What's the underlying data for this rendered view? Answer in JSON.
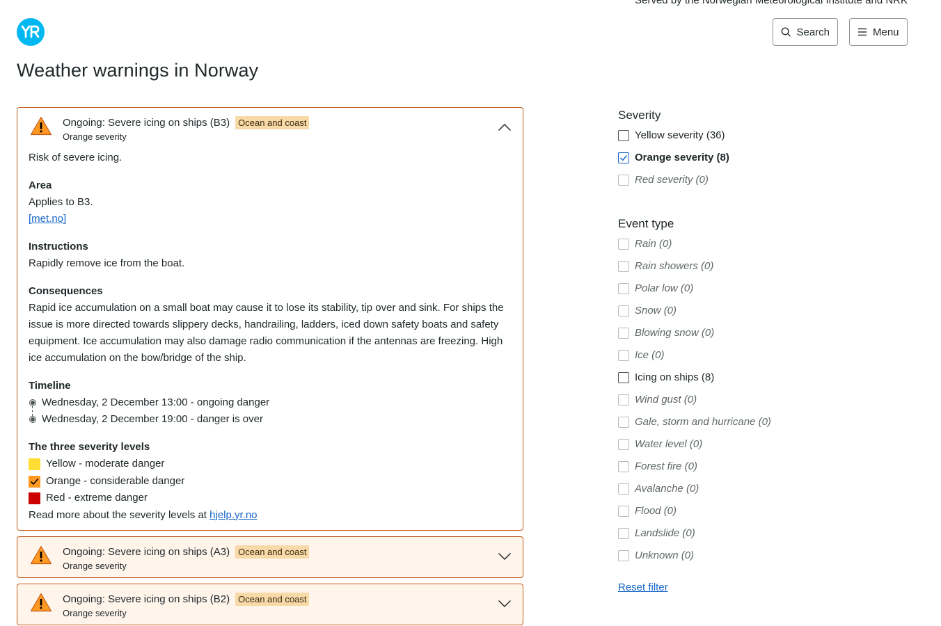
{
  "header": {
    "tagline": "Served by the Norwegian Meteorological Institute and NRK",
    "logo_text": "YR",
    "search_label": "Search",
    "menu_label": "Menu"
  },
  "page_title": "Weather warnings in Norway",
  "warnings": [
    {
      "title": "Ongoing: Severe icing on ships (B3)",
      "badge": "Ocean and coast",
      "severity": "Orange severity",
      "expanded": true,
      "description": "Risk of severe icing.",
      "area_title": "Area",
      "area_text": "Applies to B3.",
      "area_link": "[met.no]",
      "instructions_title": "Instructions",
      "instructions_text": "Rapidly remove ice from the boat.",
      "consequences_title": "Consequences",
      "consequences_text": "Rapid ice accumulation on a small boat may cause it to lose its stability, tip over and sink. For ships the issue is more directed towards slippery decks, handrailing, ladders, iced down safety boats and safety equipment. Ice accumulation may also damage radio communication if the antennas are freezing. High ice accumulation on the bow/bridge of the ship.",
      "timeline_title": "Timeline",
      "timeline": [
        "Wednesday, 2 December 13:00 - ongoing danger",
        "Wednesday, 2 December 19:00 - danger is over"
      ],
      "levels_title": "The three severity levels",
      "levels": [
        {
          "label": "Yellow - moderate danger",
          "color": "#ffdd33",
          "checked": false
        },
        {
          "label": "Orange - considerable danger",
          "color": "#ff9922",
          "checked": true
        },
        {
          "label": "Red - extreme danger",
          "color": "#cc0000",
          "checked": false
        }
      ],
      "readmore_text": "Read more about the severity levels at ",
      "readmore_link": "hjelp.yr.no"
    },
    {
      "title": "Ongoing: Severe icing on ships (A3)",
      "badge": "Ocean and coast",
      "severity": "Orange severity",
      "expanded": false
    },
    {
      "title": "Ongoing: Severe icing on ships (B2)",
      "badge": "Ocean and coast",
      "severity": "Orange severity",
      "expanded": false
    }
  ],
  "filters": {
    "severity_title": "Severity",
    "severity": [
      {
        "label": "Yellow severity (36)",
        "checked": false,
        "disabled": false
      },
      {
        "label": "Orange severity (8)",
        "checked": true,
        "disabled": false
      },
      {
        "label": "Red severity (0)",
        "checked": false,
        "disabled": true
      }
    ],
    "event_title": "Event type",
    "events": [
      {
        "label": "Rain (0)",
        "checked": false,
        "disabled": true
      },
      {
        "label": "Rain showers (0)",
        "checked": false,
        "disabled": true
      },
      {
        "label": "Polar low (0)",
        "checked": false,
        "disabled": true
      },
      {
        "label": "Snow (0)",
        "checked": false,
        "disabled": true
      },
      {
        "label": "Blowing snow (0)",
        "checked": false,
        "disabled": true
      },
      {
        "label": "Ice (0)",
        "checked": false,
        "disabled": true
      },
      {
        "label": "Icing on ships (8)",
        "checked": false,
        "disabled": false
      },
      {
        "label": "Wind gust (0)",
        "checked": false,
        "disabled": true
      },
      {
        "label": "Gale, storm and hurricane (0)",
        "checked": false,
        "disabled": true
      },
      {
        "label": "Water level (0)",
        "checked": false,
        "disabled": true
      },
      {
        "label": "Forest fire (0)",
        "checked": false,
        "disabled": true
      },
      {
        "label": "Avalanche (0)",
        "checked": false,
        "disabled": true
      },
      {
        "label": "Flood (0)",
        "checked": false,
        "disabled": true
      },
      {
        "label": "Landslide (0)",
        "checked": false,
        "disabled": true
      },
      {
        "label": "Unknown (0)",
        "checked": false,
        "disabled": true
      }
    ],
    "reset_label": "Reset filter"
  },
  "colors": {
    "brand": "#00b8f1",
    "warning_orange": "#ff9922",
    "card_border": "#c25a1a",
    "badge_bg": "#f8d9a8",
    "link": "#1464c8"
  }
}
